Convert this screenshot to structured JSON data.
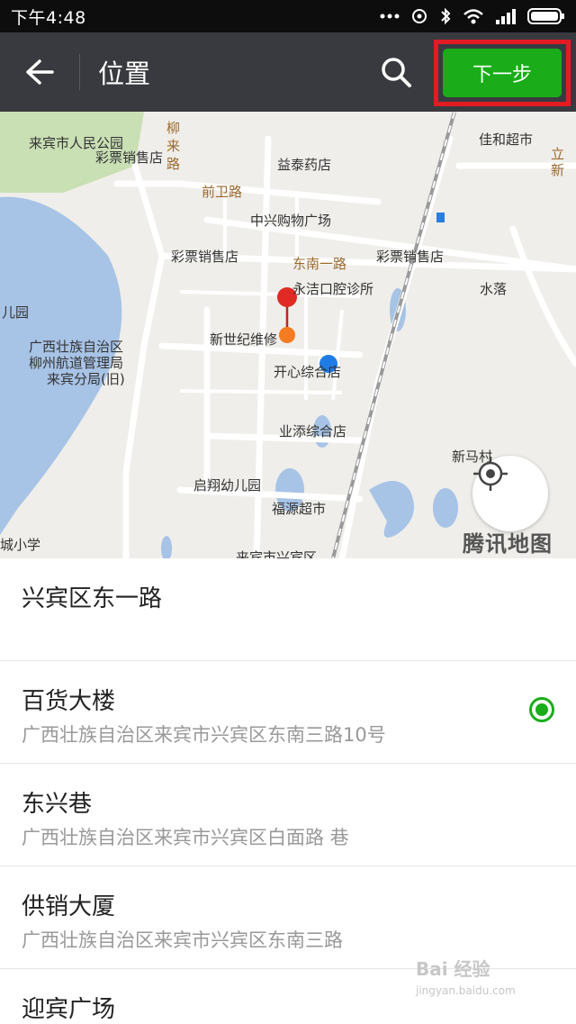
{
  "status_bar": {
    "time": "下午4:48",
    "icons": [
      "more-dots-icon",
      "sync-icon",
      "bluetooth-icon",
      "wifi-icon",
      "signal-icon",
      "battery-icon"
    ]
  },
  "action_bar": {
    "title": "位置",
    "next_label": "下一步",
    "accent_color": "#1aad19",
    "highlight_color": "#e31b23"
  },
  "map": {
    "labels": [
      {
        "text": "来宾市人民公园",
        "kind": "poi"
      },
      {
        "text": "柳来路",
        "kind": "road"
      },
      {
        "text": "益泰药店",
        "kind": "poi"
      },
      {
        "text": "佳和超市",
        "kind": "poi"
      },
      {
        "text": "彩票销售店",
        "kind": "poi"
      },
      {
        "text": "前卫路",
        "kind": "road"
      },
      {
        "text": "立新",
        "kind": "road"
      },
      {
        "text": "中兴购物广场",
        "kind": "poi"
      },
      {
        "text": "彩票销售店",
        "kind": "poi"
      },
      {
        "text": "东南一路",
        "kind": "road"
      },
      {
        "text": "彩票销售店",
        "kind": "poi"
      },
      {
        "text": "永洁口腔诊所",
        "kind": "poi"
      },
      {
        "text": "水落",
        "kind": "area"
      },
      {
        "text": "儿园",
        "kind": "area"
      },
      {
        "text": "广西壮族自治区",
        "kind": "poi"
      },
      {
        "text": "柳州航道管理局",
        "kind": "poi"
      },
      {
        "text": "来宾分局(旧)",
        "kind": "poi"
      },
      {
        "text": "新世纪维修",
        "kind": "poi"
      },
      {
        "text": "开心综合店",
        "kind": "poi"
      },
      {
        "text": "业添综合店",
        "kind": "poi"
      },
      {
        "text": "新马村",
        "kind": "area"
      },
      {
        "text": "启翔幼儿园",
        "kind": "poi"
      },
      {
        "text": "福源超市",
        "kind": "poi"
      },
      {
        "text": "城小学",
        "kind": "area"
      },
      {
        "text": "来宾市兴宾区",
        "kind": "area"
      }
    ],
    "brand": "腾讯地图",
    "locate_icon": "crosshair-icon"
  },
  "places": [
    {
      "name": "兴宾区东一路",
      "address": "",
      "selected": false
    },
    {
      "name": "百货大楼",
      "address": "广西壮族自治区来宾市兴宾区东南三路10号",
      "selected": true
    },
    {
      "name": "东兴巷",
      "address": "广西壮族自治区来宾市兴宾区白面路 巷",
      "selected": false
    },
    {
      "name": "供销大厦",
      "address": "广西壮族自治区来宾市兴宾区东南三路",
      "selected": false
    },
    {
      "name": "迎宾广场",
      "address": "",
      "selected": false
    }
  ],
  "watermark": {
    "main": "Bai 经验",
    "sub": "jingyan.baidu.com"
  }
}
